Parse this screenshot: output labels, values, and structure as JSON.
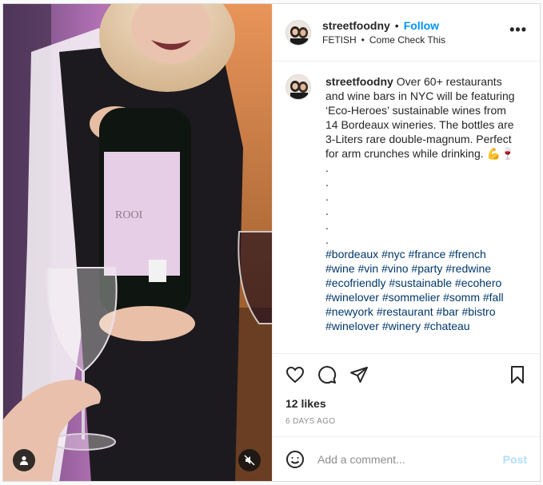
{
  "post": {
    "username": "streetfoodny",
    "follow_label": "Follow",
    "separator": "•",
    "audio_artist": "FETISH",
    "audio_title": "Come Check This",
    "more_label": "•••"
  },
  "caption": {
    "username": "streetfoodny",
    "text": "Over 60+ restaurants and wine bars in NYC will be featuring ‘Eco-Heroes’ sustainable wines from 14 Bordeaux wineries. The bottles are 3-Liters rare double-magnum. Perfect for arm crunches while drinking. 💪🍷",
    "dots": [
      ".",
      ".",
      ".",
      ".",
      ".",
      "."
    ],
    "hashtags": [
      "#bordeaux",
      "#nyc",
      "#france",
      "#french",
      "#wine",
      "#vin",
      "#vino",
      "#party",
      "#redwine",
      "#ecofriendly",
      "#sustainable",
      "#ecohero",
      "#winelover",
      "#sommelier",
      "#somm",
      "#fall",
      "#newyork",
      "#restaurant",
      "#bar",
      "#bistro",
      "#winelover",
      "#winery",
      "#chateau"
    ]
  },
  "engagement": {
    "likes": "12 likes",
    "timestamp": "6 DAYS AGO"
  },
  "comment": {
    "placeholder": "Add a comment...",
    "post_label": "Post"
  },
  "media": {
    "bottle_label": "ROOI",
    "icons": [
      "user-tag-icon",
      "mute-icon"
    ]
  },
  "colors": {
    "link": "#0095f6",
    "hashtag": "#00376b",
    "post_disabled": "#b2dffc",
    "muted_text": "#8e8e8e"
  }
}
